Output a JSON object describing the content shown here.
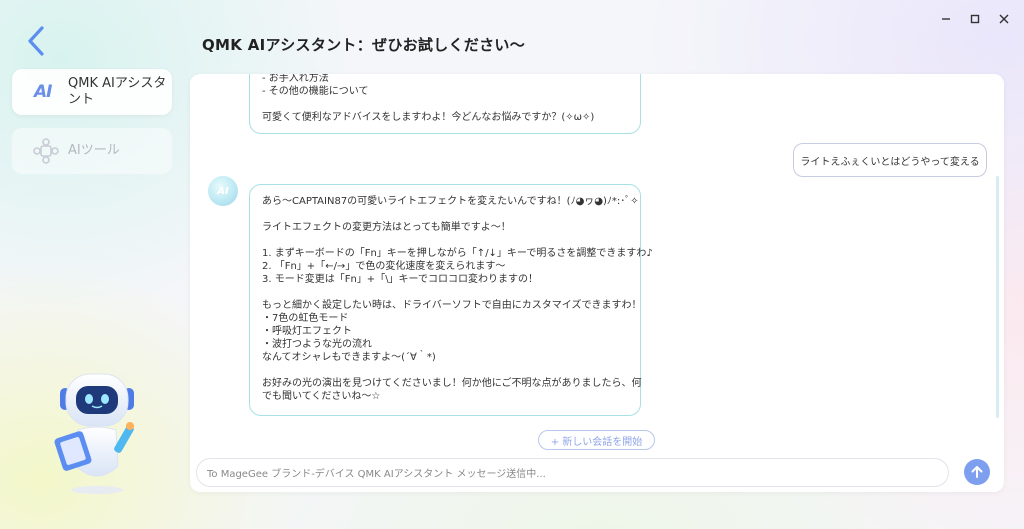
{
  "window": {
    "minimize_glyph": "—",
    "maximize_glyph": "□",
    "close_glyph": "✕"
  },
  "header": {
    "title": "QMK AIアシスタント：ぜひお試しください～"
  },
  "sidebar": {
    "items": [
      {
        "label_line1": "QMK AIアシスタ",
        "label_line2": "ント",
        "icon": "ai-text-icon",
        "active": true
      },
      {
        "label": "AIツール",
        "icon": "puzzle-icon",
        "active": false
      }
    ]
  },
  "chat": {
    "prev_message_lines": [
      "- お手入れ方法",
      "- その他の機能について",
      "",
      "可愛くて便利なアドバイスをしますわよ！今どんなお悩みですか？(✧ω✧)"
    ],
    "user_message": "ライトえふぇくいとはどうやって変える",
    "ai_reply_lines": [
      "あら～CAPTAIN87の可愛いライトエフェクトを変えたいんですね！(ﾉ◕ヮ◕)ﾉ*:･ﾟ✧",
      "",
      "ライトエフェクトの変更方法はとっても簡単ですよ～！",
      "",
      "1. まずキーボードの「Fn」キーを押しながら「↑/↓」キーで明るさを調整できますわ♪",
      "2. 「Fn」+「←/→」で色の変化速度を変えられます～",
      "3. モード変更は「Fn」+「\\」キーでコロコロ変わりますの！",
      "",
      "もっと細かく設定したい時は、ドライバーソフトで自由にカスタマイズできますわ！",
      "・7色の虹色モード",
      "・呼吸灯エフェクト",
      "・波打つような光の流れ",
      "なんてオシャレもできますよ～(´∀｀*)",
      "",
      "お好みの光の演出を見つけてくださいまし！何か他にご不明な点がありましたら、何",
      "でも聞いてくださいね～☆"
    ],
    "avatar_label": "AI",
    "new_chat_label": "+ 新しい会話を開始",
    "input_placeholder": "To MageGee ブランド-デバイス QMK AIアシスタント メッセージ送信中..."
  },
  "colors": {
    "accent": "#7e9ef0",
    "bubble_border": "#a8e0e3",
    "back_arrow": "#5b8ef0"
  }
}
